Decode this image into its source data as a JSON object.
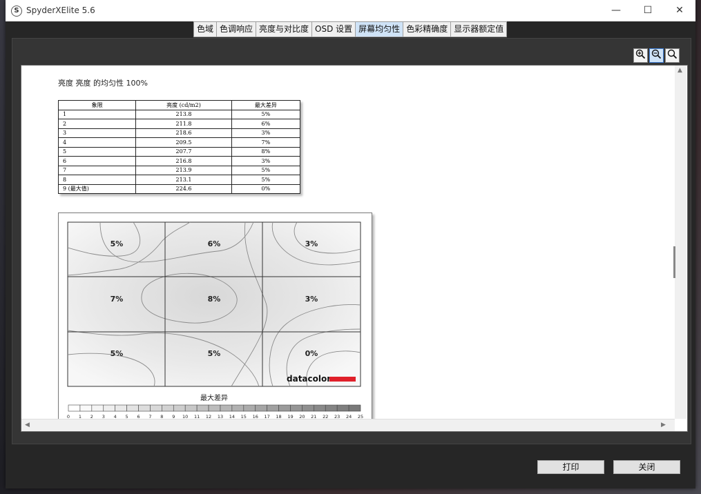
{
  "window": {
    "title": "SpyderXElite 5.6",
    "app_icon": "S"
  },
  "titlebar_controls": {
    "minimize": "—",
    "maximize": "☐",
    "close": "✕"
  },
  "tabs": [
    {
      "label": "色域",
      "active": false
    },
    {
      "label": "色调响应",
      "active": false
    },
    {
      "label": "亮度与对比度",
      "active": false
    },
    {
      "label": "OSD 设置",
      "active": false
    },
    {
      "label": "屏幕均匀性",
      "active": true
    },
    {
      "label": "色彩精确度",
      "active": false
    },
    {
      "label": "显示器额定值",
      "active": false
    }
  ],
  "zoom": {
    "in_icon": "zoom-in-icon",
    "out_icon": "zoom-out-icon",
    "fit_icon": "zoom-fit-icon"
  },
  "report": {
    "title": "亮度 亮度 的均匀性 100%",
    "table": {
      "headers": [
        "象限",
        "亮度 (cd/m2)",
        "最大差异"
      ],
      "rows": [
        [
          "1",
          "213.8",
          "5%"
        ],
        [
          "2",
          "211.8",
          "6%"
        ],
        [
          "3",
          "218.6",
          "3%"
        ],
        [
          "4",
          "209.5",
          "7%"
        ],
        [
          "5",
          "207.7",
          "8%"
        ],
        [
          "6",
          "216.8",
          "3%"
        ],
        [
          "7",
          "213.9",
          "5%"
        ],
        [
          "8",
          "213.1",
          "5%"
        ],
        [
          "9 (最大值)",
          "224.6",
          "0%"
        ]
      ]
    },
    "grid": {
      "cells": [
        "5%",
        "6%",
        "3%",
        "7%",
        "8%",
        "3%",
        "5%",
        "5%",
        "0%"
      ],
      "logo": "datacolor",
      "logo_color": "#e0202a"
    },
    "scale": {
      "label": "最大差异",
      "ticks": [
        "0",
        "1",
        "2",
        "3",
        "4",
        "5",
        "6",
        "7",
        "8",
        "9",
        "10",
        "11",
        "12",
        "13",
        "14",
        "15",
        "16",
        "17",
        "18",
        "19",
        "20",
        "21",
        "22",
        "23",
        "24",
        "25"
      ]
    }
  },
  "buttons": {
    "print": "打印",
    "close": "关闭"
  }
}
